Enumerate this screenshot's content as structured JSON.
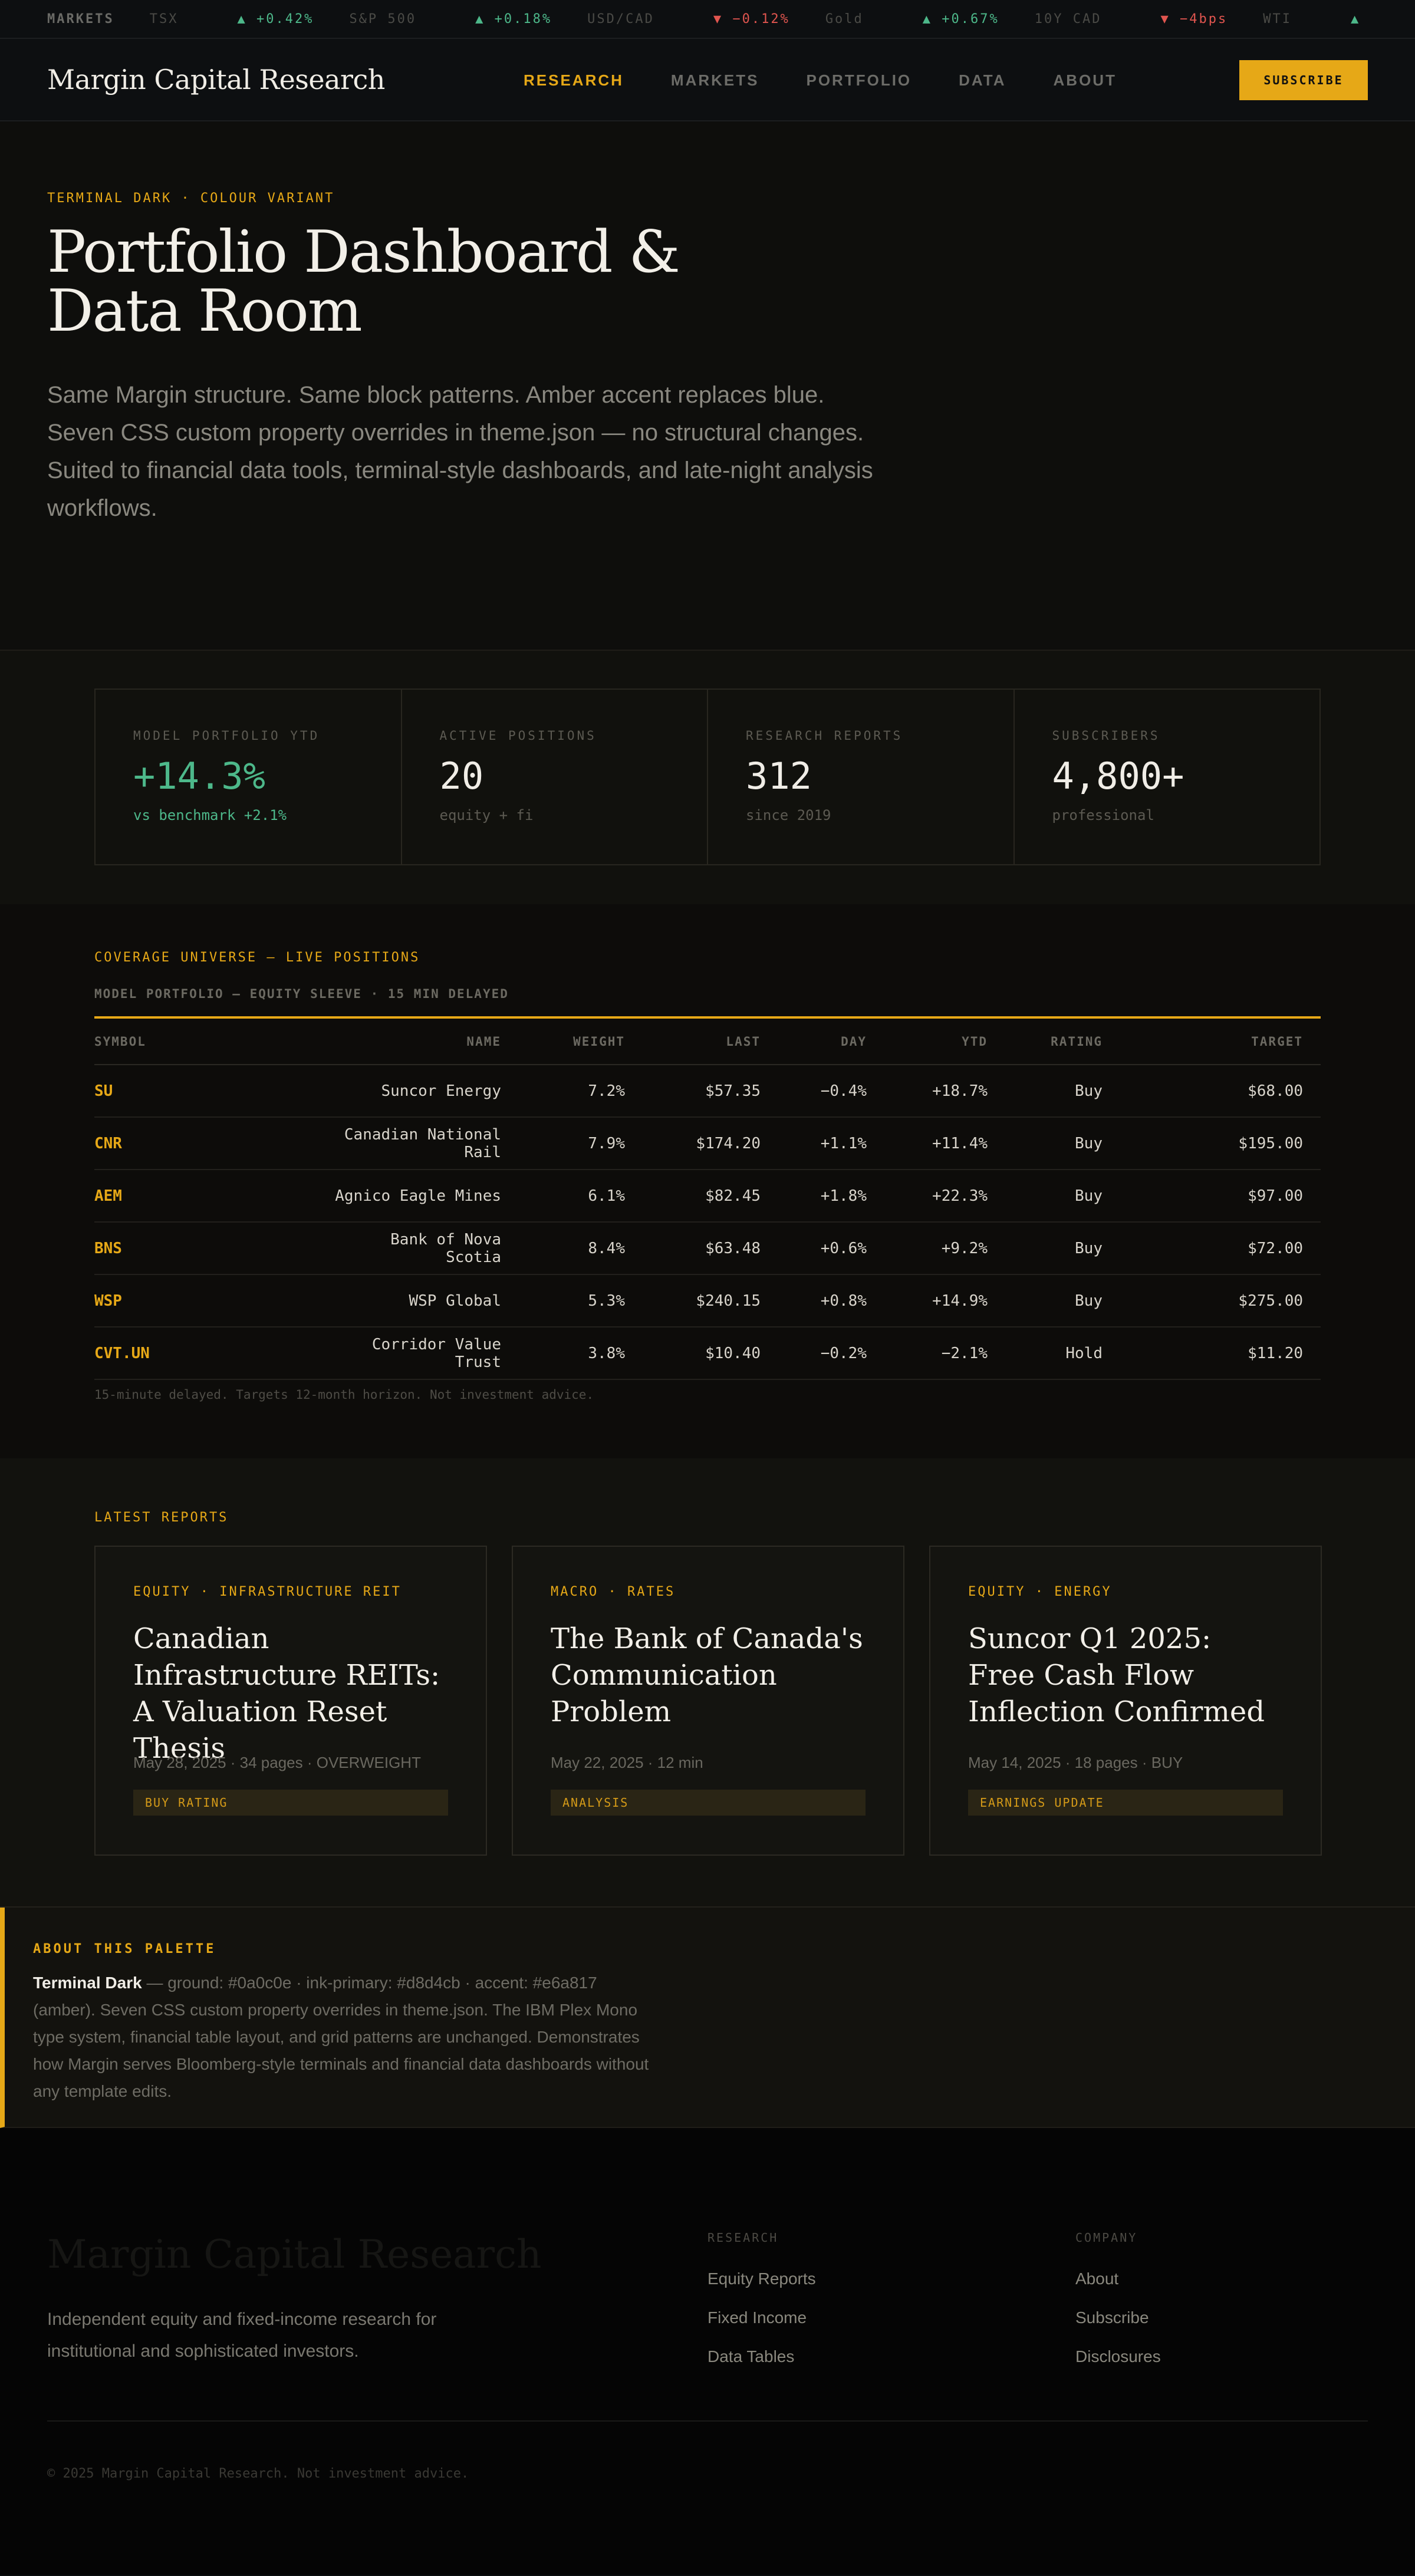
{
  "ticker": {
    "label": "MARKETS",
    "items": [
      {
        "symbol": "TSX",
        "change": "▲ +0.42%",
        "dir": "up"
      },
      {
        "symbol": "S&P 500",
        "change": "▲ +0.18%",
        "dir": "up"
      },
      {
        "symbol": "USD/CAD",
        "change": "▼ −0.12%",
        "dir": "dn"
      },
      {
        "symbol": "Gold",
        "change": "▲ +0.67%",
        "dir": "up"
      },
      {
        "symbol": "10Y CAD",
        "change": "▼ −4bps",
        "dir": "dn"
      },
      {
        "symbol": "WTI",
        "change": "▲",
        "dir": "up"
      }
    ]
  },
  "nav": {
    "brand": "Margin Capital Research",
    "links": [
      "RESEARCH",
      "MARKETS",
      "PORTFOLIO",
      "DATA",
      "ABOUT"
    ],
    "active_index": 0,
    "subscribe_label": "SUBSCRIBE"
  },
  "hero": {
    "eyebrow": "TERMINAL DARK · COLOUR VARIANT",
    "title": "Portfolio Dashboard & Data Room",
    "intro": "Same Margin structure. Same block patterns. Amber accent replaces blue. Seven CSS custom property overrides in theme.json — no structural changes. Suited to financial data tools, terminal-style dashboards, and late-night analysis workflows."
  },
  "stats": [
    {
      "label": "MODEL PORTFOLIO YTD",
      "value": "+14.3%",
      "sub": "vs benchmark +2.1%",
      "accent": "green"
    },
    {
      "label": "ACTIVE POSITIONS",
      "value": "20",
      "sub": "equity + fi",
      "accent": ""
    },
    {
      "label": "RESEARCH REPORTS",
      "value": "312",
      "sub": "since 2019",
      "accent": ""
    },
    {
      "label": "SUBSCRIBERS",
      "value": "4,800+",
      "sub": "professional",
      "accent": ""
    }
  ],
  "coverage": {
    "eyebrow": "COVERAGE UNIVERSE — LIVE POSITIONS",
    "subtitle": "MODEL PORTFOLIO — EQUITY SLEEVE · 15 MIN DELAYED",
    "columns": [
      "SYMBOL",
      "NAME",
      "WEIGHT",
      "LAST",
      "DAY",
      "YTD",
      "RATING",
      "TARGET"
    ],
    "rows": [
      [
        "SU",
        "Suncor Energy",
        "7.2%",
        "$57.35",
        "−0.4%",
        "+18.7%",
        "Buy",
        "$68.00"
      ],
      [
        "CNR",
        "Canadian National Rail",
        "7.9%",
        "$174.20",
        "+1.1%",
        "+11.4%",
        "Buy",
        "$195.00"
      ],
      [
        "AEM",
        "Agnico Eagle Mines",
        "6.1%",
        "$82.45",
        "+1.8%",
        "+22.3%",
        "Buy",
        "$97.00"
      ],
      [
        "BNS",
        "Bank of Nova Scotia",
        "8.4%",
        "$63.48",
        "+0.6%",
        "+9.2%",
        "Buy",
        "$72.00"
      ],
      [
        "WSP",
        "WSP Global",
        "5.3%",
        "$240.15",
        "+0.8%",
        "+14.9%",
        "Buy",
        "$275.00"
      ],
      [
        "CVT.UN",
        "Corridor Value Trust",
        "3.8%",
        "$10.40",
        "−0.2%",
        "−2.1%",
        "Hold",
        "$11.20"
      ]
    ],
    "footnote": "15-minute delayed. Targets 12-month horizon. Not investment advice."
  },
  "reports": {
    "eyebrow": "LATEST REPORTS",
    "cards": [
      {
        "tag": "EQUITY · INFRASTRUCTURE REIT",
        "title": "Canadian Infrastructure REITs: A Valuation Reset Thesis",
        "meta": "May 28, 2025 · 34 pages · OVERWEIGHT",
        "badge": "BUY RATING"
      },
      {
        "tag": "MACRO · RATES",
        "title": "The Bank of Canada's Communication Problem",
        "meta": "May 22, 2025 · 12 min",
        "badge": "ANALYSIS"
      },
      {
        "tag": "EQUITY · ENERGY",
        "title": "Suncor Q1 2025: Free Cash Flow Inflection Confirmed",
        "meta": "May 14, 2025 · 18 pages · BUY",
        "badge": "EARNINGS UPDATE"
      }
    ]
  },
  "palette": {
    "eyebrow": "ABOUT THIS PALETTE",
    "name": "Terminal Dark",
    "text": " — ground: #0a0c0e · ink-primary: #d8d4cb · accent: #e6a817 (amber). Seven CSS custom property overrides in theme.json. The IBM Plex Mono type system, financial table layout, and grid patterns are unchanged. Demonstrates how Margin serves Bloomberg-style terminals and financial data dashboards without any template edits."
  },
  "footer": {
    "brand": "Margin Capital Research",
    "description": "Independent equity and fixed-income research for institutional and sophisticated investors.",
    "research_heading": "RESEARCH",
    "research_links": [
      "Equity Reports",
      "Fixed Income",
      "Data Tables"
    ],
    "company_heading": "COMPANY",
    "company_links": [
      "About",
      "Subscribe",
      "Disclosures"
    ],
    "copyright": "© 2025 Margin Capital Research. Not investment advice."
  },
  "colors": {
    "ground": "#0a0c0e",
    "ink_primary": "#d8d4cb",
    "accent": "#e6a817",
    "up": "#4db88a",
    "down": "#e0554f"
  }
}
